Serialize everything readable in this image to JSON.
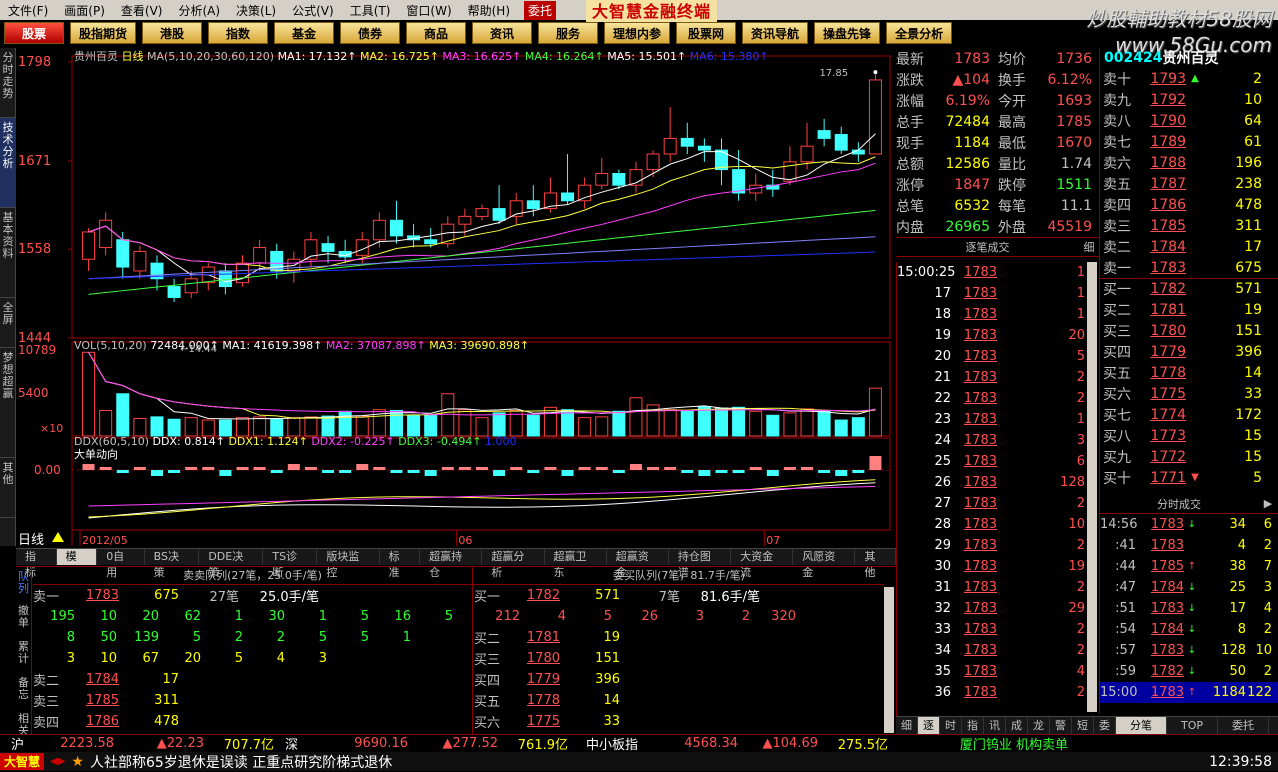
{
  "menu": {
    "items": [
      "文件(F)",
      "画面(P)",
      "查看(V)",
      "分析(A)",
      "决策(L)",
      "公式(V)",
      "工具(T)",
      "窗口(W)",
      "帮助(H)"
    ],
    "entrust": "委托",
    "app_title": "大智慧金融终端"
  },
  "watermark": {
    "line1": "炒股輔助教材58股网",
    "line2": "www.58Gu.com"
  },
  "toolbar": [
    "股票",
    "股指期货",
    "港股",
    "指数",
    "基金",
    "债券",
    "商品",
    "资讯",
    "服务",
    "理想内参",
    "股票网",
    "资讯导航",
    "操盘先锋",
    "全景分析"
  ],
  "lefttabs": [
    "分时走势",
    "技术分析",
    "基本资料",
    "全屏",
    "梦想超赢",
    "其他"
  ],
  "chart": {
    "stock_name": "贵州百灵",
    "period": "日线",
    "ma_line": "MA(5,10,20,30,60,120)",
    "ma1": "MA1: 17.132↑",
    "ma2": "MA2: 16.725↑",
    "ma3": "MA3: 16.625↑",
    "ma4": "MA4: 16.264↑",
    "ma5": "MA5: 15.501↑",
    "ma6": "MA6: 15.380↑",
    "y_labels": [
      "1798",
      "1671",
      "1558",
      "1444"
    ],
    "high_label": "17.85",
    "low_label": "14.44",
    "vol_title": "VOL(5,10,20)",
    "vol_val": "72484.000↑",
    "vol_ma1": "MA1: 41619.398↑",
    "vol_ma2": "MA2: 37087.898↑",
    "vol_ma3": "MA3: 39690.898↑",
    "vol_y": [
      "10789",
      "5400"
    ],
    "vol_unit": "×10",
    "ddx_title": "DDX(60,5,10)",
    "ddx": "DDX: 0.814↑",
    "ddx1": "DDX1: 1.124↑",
    "ddx2": "DDX2: -0.225↑",
    "ddx3": "DDX3: -0.494↑",
    "ddx_extra": "1.000",
    "ddx_label": "大单动向",
    "ddx_y": "0.00",
    "x_labels": [
      "2012/05",
      "06",
      "07"
    ],
    "period_label": "日线"
  },
  "chart_data": {
    "type": "candlestick",
    "candles": [
      [
        15.45,
        15.8,
        15.3,
        15.85
      ],
      [
        15.6,
        15.95,
        15.5,
        16.05
      ],
      [
        15.7,
        15.35,
        15.2,
        15.8
      ],
      [
        15.3,
        15.55,
        15.2,
        15.62
      ],
      [
        15.4,
        15.2,
        15.05,
        15.5
      ],
      [
        15.1,
        14.96,
        14.9,
        15.2
      ],
      [
        15.02,
        15.2,
        14.95,
        15.3
      ],
      [
        15.15,
        15.35,
        15.05,
        15.4
      ],
      [
        15.3,
        15.1,
        15.0,
        15.4
      ],
      [
        15.15,
        15.4,
        15.1,
        15.5
      ],
      [
        15.4,
        15.6,
        15.3,
        15.7
      ],
      [
        15.55,
        15.3,
        15.2,
        15.65
      ],
      [
        15.3,
        15.45,
        15.15,
        15.55
      ],
      [
        15.45,
        15.7,
        15.35,
        15.8
      ],
      [
        15.65,
        15.55,
        15.4,
        15.75
      ],
      [
        15.55,
        15.48,
        15.4,
        15.7
      ],
      [
        15.5,
        15.7,
        15.4,
        15.8
      ],
      [
        15.7,
        15.95,
        15.6,
        16.05
      ],
      [
        15.95,
        15.75,
        15.65,
        16.2
      ],
      [
        15.75,
        15.7,
        15.6,
        15.9
      ],
      [
        15.7,
        15.65,
        15.6,
        15.85
      ],
      [
        15.65,
        15.9,
        15.6,
        16.0
      ],
      [
        15.9,
        16.0,
        15.75,
        16.1
      ],
      [
        16.0,
        16.1,
        15.95,
        16.15
      ],
      [
        16.1,
        15.95,
        15.9,
        16.4
      ],
      [
        16.0,
        16.2,
        15.9,
        16.3
      ],
      [
        16.2,
        16.1,
        16.0,
        16.4
      ],
      [
        16.1,
        16.3,
        16.05,
        16.5
      ],
      [
        16.3,
        16.2,
        16.15,
        16.8
      ],
      [
        16.2,
        16.4,
        16.1,
        16.5
      ],
      [
        16.4,
        16.55,
        16.35,
        16.75
      ],
      [
        16.55,
        16.4,
        16.35,
        16.6
      ],
      [
        16.4,
        16.6,
        16.3,
        16.7
      ],
      [
        16.6,
        16.8,
        16.5,
        16.85
      ],
      [
        16.8,
        17.0,
        16.7,
        17.4
      ],
      [
        17.0,
        16.9,
        16.8,
        17.2
      ],
      [
        16.9,
        16.85,
        16.7,
        17.0
      ],
      [
        16.85,
        16.6,
        16.4,
        17.0
      ],
      [
        16.6,
        16.3,
        16.2,
        16.85
      ],
      [
        16.3,
        16.4,
        16.2,
        16.55
      ],
      [
        16.4,
        16.35,
        16.25,
        16.6
      ],
      [
        16.45,
        16.7,
        16.4,
        16.9
      ],
      [
        16.7,
        16.9,
        16.6,
        17.2
      ],
      [
        17.1,
        17.0,
        16.9,
        17.25
      ],
      [
        17.05,
        16.85,
        16.8,
        17.15
      ],
      [
        16.85,
        16.8,
        16.7,
        16.95
      ],
      [
        16.8,
        17.75,
        16.8,
        17.85
      ]
    ],
    "volume": [
      10500,
      3200,
      5300,
      2200,
      2400,
      2100,
      2300,
      2000,
      2000,
      2300,
      2400,
      2200,
      2300,
      2400,
      2500,
      3100,
      2500,
      3300,
      3200,
      2600,
      2600,
      5300,
      3300,
      2300,
      2900,
      3200,
      2600,
      3600,
      3300,
      2300,
      2400,
      3100,
      4800,
      3900,
      3300,
      3200,
      3700,
      3500,
      3600,
      3100,
      2600,
      2900,
      3400,
      3200,
      2000,
      2300,
      6000
    ],
    "ylim": [
      14.44,
      17.98
    ],
    "vol_ylim": [
      0,
      10789
    ],
    "xlabel": "",
    "ylabel": ""
  },
  "tabs": [
    "指标",
    "模板",
    "0自用",
    "BS决策",
    "DDE决策",
    "TS诊断",
    "版块监控",
    "标准",
    "超赢持仓",
    "超赢分析",
    "超赢卫东",
    "超赢资金",
    "持仓图谱",
    "大资金流",
    "风愿资金",
    "其他"
  ],
  "queue": {
    "side_label": "队列",
    "sell_title": "卖卖队列(27笔，25.0手/笔)",
    "buy_title": "委买队列(7笔，81.7手/笔)",
    "sell_head": [
      "卖一",
      "1783",
      "675",
      "27笔",
      "25.0手/笔"
    ],
    "sell_q1": [
      "195",
      "10",
      "20",
      "62",
      "1",
      "30",
      "1",
      "5",
      "16",
      "5"
    ],
    "sell_q2": [
      "8",
      "50",
      "139",
      "5",
      "2",
      "2",
      "5",
      "5",
      "1"
    ],
    "sell_q3": [
      "3",
      "10",
      "67",
      "20",
      "5",
      "4",
      "3"
    ],
    "sell_rows": [
      [
        "卖二",
        "1784",
        "17"
      ],
      [
        "卖三",
        "1785",
        "311"
      ],
      [
        "卖四",
        "1786",
        "478"
      ]
    ],
    "buy_head": [
      "买一",
      "1782",
      "571",
      "7笔",
      "81.6手/笔"
    ],
    "buy_q1": [
      "212",
      "4",
      "5",
      "26",
      "3",
      "2",
      "320"
    ],
    "buy_rows": [
      [
        "买二",
        "1781",
        "19"
      ],
      [
        "买三",
        "1780",
        "151"
      ],
      [
        "买四",
        "1779",
        "396"
      ],
      [
        "买五",
        "1778",
        "14"
      ],
      [
        "买六",
        "1775",
        "33"
      ]
    ],
    "side_sub": [
      "撤单",
      "累计",
      "备忘",
      "相关"
    ]
  },
  "quote": {
    "rows": [
      [
        "最新",
        "1783",
        "均价",
        "1736"
      ],
      [
        "涨跌",
        "▲104",
        "换手",
        "6.12%"
      ],
      [
        "涨幅",
        "6.19%",
        "今开",
        "1693"
      ],
      [
        "总手",
        "72484",
        "最高",
        "1785"
      ],
      [
        "现手",
        "1184",
        "最低",
        "1670"
      ],
      [
        "总额",
        "12586",
        "量比",
        "1.74"
      ],
      [
        "涨停",
        "1847",
        "跌停",
        "1511"
      ],
      [
        "总笔",
        "6532",
        "每笔",
        "11.1"
      ],
      [
        "内盘",
        "26965",
        "外盘",
        "45519"
      ]
    ],
    "tick_title": "逐笔成交",
    "tick_btn": "细"
  },
  "ticks": [
    [
      "15:00:25",
      "1783",
      "1"
    ],
    [
      "17",
      "1783",
      "1"
    ],
    [
      "18",
      "1783",
      "1"
    ],
    [
      "19",
      "1783",
      "20"
    ],
    [
      "20",
      "1783",
      "5"
    ],
    [
      "21",
      "1783",
      "2"
    ],
    [
      "22",
      "1783",
      "2"
    ],
    [
      "23",
      "1783",
      "1"
    ],
    [
      "24",
      "1783",
      "3"
    ],
    [
      "25",
      "1783",
      "6"
    ],
    [
      "26",
      "1783",
      "128"
    ],
    [
      "27",
      "1783",
      "2"
    ],
    [
      "28",
      "1783",
      "10"
    ],
    [
      "29",
      "1783",
      "2"
    ],
    [
      "30",
      "1783",
      "19"
    ],
    [
      "31",
      "1783",
      "2"
    ],
    [
      "32",
      "1783",
      "29"
    ],
    [
      "33",
      "1783",
      "2"
    ],
    [
      "34",
      "1783",
      "2"
    ],
    [
      "35",
      "1783",
      "4"
    ],
    [
      "36",
      "1783",
      "2"
    ]
  ],
  "orderbook": {
    "code": "002424",
    "name": "贵州百灵",
    "rows": [
      [
        "卖十",
        "1793",
        "▲",
        "2"
      ],
      [
        "卖九",
        "1792",
        "",
        "10"
      ],
      [
        "卖八",
        "1790",
        "",
        "64"
      ],
      [
        "卖七",
        "1789",
        "",
        "61"
      ],
      [
        "卖六",
        "1788",
        "",
        "196"
      ],
      [
        "卖五",
        "1787",
        "",
        "238"
      ],
      [
        "卖四",
        "1786",
        "",
        "478"
      ],
      [
        "卖三",
        "1785",
        "",
        "311"
      ],
      [
        "卖二",
        "1784",
        "",
        "17"
      ],
      [
        "卖一",
        "1783",
        "",
        "675"
      ],
      [
        "买一",
        "1782",
        "",
        "571"
      ],
      [
        "买二",
        "1781",
        "",
        "19"
      ],
      [
        "买三",
        "1780",
        "",
        "151"
      ],
      [
        "买四",
        "1779",
        "",
        "396"
      ],
      [
        "买五",
        "1778",
        "",
        "14"
      ],
      [
        "买六",
        "1775",
        "",
        "33"
      ],
      [
        "买七",
        "1774",
        "",
        "172"
      ],
      [
        "买八",
        "1773",
        "",
        "15"
      ],
      [
        "买九",
        "1772",
        "",
        "15"
      ],
      [
        "买十",
        "1771",
        "▼",
        "5"
      ]
    ],
    "fs_title": "分时成交"
  },
  "fenshi": [
    [
      "14:56",
      "1783",
      "↓",
      "34",
      "6"
    ],
    [
      ":41",
      "1783",
      "",
      "4",
      "2"
    ],
    [
      ":44",
      "1785",
      "↑",
      "38",
      "7"
    ],
    [
      ":47",
      "1784",
      "↓",
      "25",
      "3"
    ],
    [
      ":51",
      "1783",
      "↓",
      "17",
      "4"
    ],
    [
      ":54",
      "1784",
      "↓",
      "8",
      "2"
    ],
    [
      ":57",
      "1783",
      "↓",
      "128",
      "10"
    ],
    [
      ":59",
      "1782",
      "↓",
      "50",
      "2"
    ],
    [
      "15:00",
      "1783",
      "↑",
      "1184",
      "122"
    ]
  ],
  "bottomtabs": [
    "细",
    "逐",
    "时",
    "指",
    "讯",
    "成",
    "龙",
    "警",
    "短",
    "委",
    "分笔",
    "TOP",
    "委托"
  ],
  "status": {
    "sh": "沪",
    "sh_idx": "2223.58",
    "sh_chg": "▲22.23",
    "sh_amt": "707.7亿",
    "sz": "深",
    "sz_idx": "9690.16",
    "sz_chg": "▲277.52",
    "sz_amt": "761.9亿",
    "zx": "中小板指",
    "zx_idx": "4568.34",
    "zx_chg": "▲104.69",
    "zx_amt": "275.5亿",
    "note": "厦门钨业 机构卖单"
  },
  "news": {
    "brand": "大智慧",
    "text": "人社部称65岁退休是误读 正重点研究阶梯式退休",
    "time": "12:39:58"
  }
}
